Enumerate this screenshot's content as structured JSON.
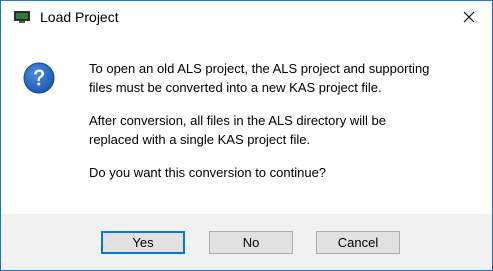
{
  "window": {
    "title": "Load Project",
    "close_icon": "close-icon",
    "app_icon": "monitor-icon"
  },
  "message": {
    "icon": "question-icon",
    "paragraph1": "To open an old ALS project, the ALS project and supporting\nfiles must be converted into a new KAS project file.",
    "paragraph2": "After conversion, all files in the ALS directory will be\nreplaced with a single KAS project file.",
    "paragraph3": "Do you want this conversion to continue?"
  },
  "buttons": {
    "yes": "Yes",
    "no": "No",
    "cancel": "Cancel"
  },
  "colors": {
    "accent": "#0078d7",
    "footer_bg": "#f0f0f0",
    "button_bg": "#e1e1e1",
    "question_icon": "#1c5fb8"
  }
}
